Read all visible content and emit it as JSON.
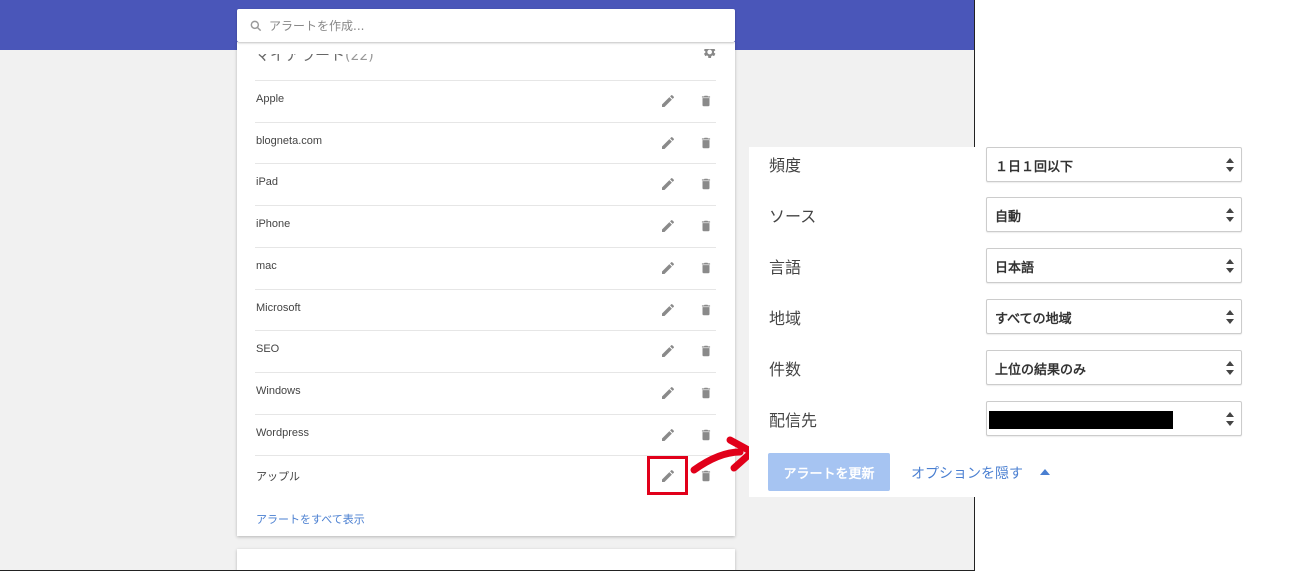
{
  "search": {
    "placeholder": "アラートを作成..."
  },
  "card": {
    "title": "マイアラート",
    "count": "(22)",
    "alerts": [
      {
        "label": "Apple"
      },
      {
        "label": "blogneta.com"
      },
      {
        "label": "iPad"
      },
      {
        "label": "iPhone"
      },
      {
        "label": "mac"
      },
      {
        "label": "Microsoft"
      },
      {
        "label": "SEO"
      },
      {
        "label": "Windows"
      },
      {
        "label": "Wordpress"
      },
      {
        "label": "アップル"
      }
    ],
    "show_all": "アラートをすべて表示"
  },
  "options": {
    "frequency": {
      "label": "頻度",
      "value": "１日１回以下"
    },
    "source": {
      "label": "ソース",
      "value": "自動"
    },
    "language": {
      "label": "言語",
      "value": "日本語"
    },
    "region": {
      "label": "地域",
      "value": "すべての地域"
    },
    "count": {
      "label": "件数",
      "value": "上位の結果のみ"
    },
    "deliver_to": {
      "label": "配信先"
    }
  },
  "actions": {
    "update_label": "アラートを更新",
    "hide_options_label": "オプションを隠す"
  },
  "colors": {
    "topbar": "#4a56b9",
    "link": "#4a7fd1",
    "update_button": "#a6c4f2",
    "highlight": "#e1001a"
  }
}
